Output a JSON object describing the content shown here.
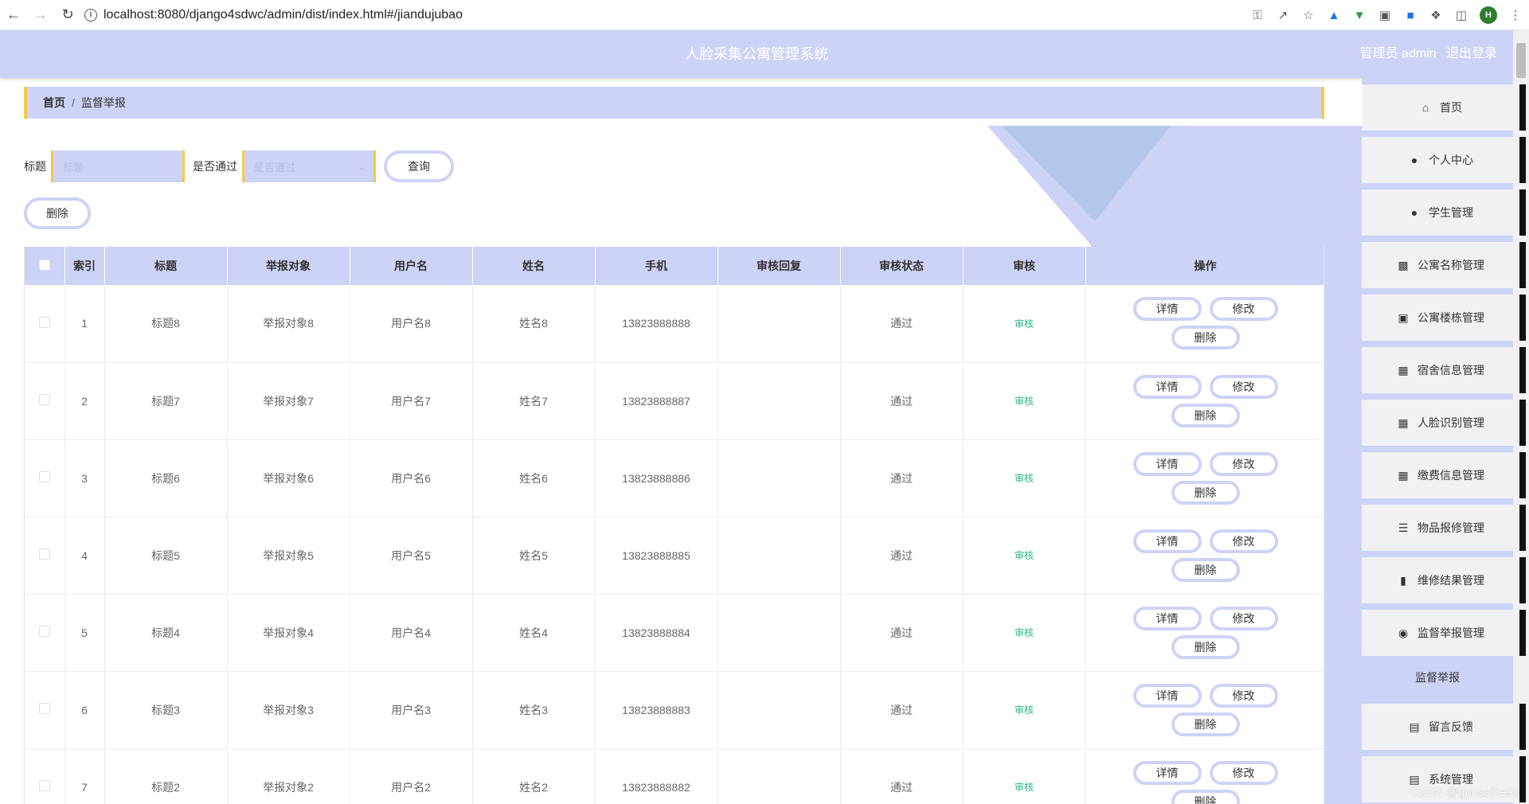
{
  "browser": {
    "url": "localhost:8080/django4sdwc/admin/dist/index.html#/jiandujubao"
  },
  "header": {
    "title": "人脸采集公寓管理系统",
    "user_role": "管理员 admin",
    "logout": "退出登录"
  },
  "breadcrumb": {
    "home": "首页",
    "separator": "/",
    "current": "监督举报"
  },
  "search": {
    "title_label": "标题",
    "title_placeholder": "标题",
    "pass_label": "是否通过",
    "pass_placeholder": "是否通过",
    "query_button": "查询"
  },
  "actions": {
    "delete_button": "删除"
  },
  "table": {
    "headers": [
      "索引",
      "标题",
      "举报对象",
      "用户名",
      "姓名",
      "手机",
      "审核回复",
      "审核状态",
      "审核",
      "操作"
    ],
    "audit_link": "审核",
    "op_detail": "详情",
    "op_edit": "修改",
    "op_delete": "删除",
    "rows": [
      {
        "index": "1",
        "title": "标题8",
        "target": "举报对象8",
        "username": "用户名8",
        "name": "姓名8",
        "phone": "13823888888",
        "reply": "",
        "status": "通过"
      },
      {
        "index": "2",
        "title": "标题7",
        "target": "举报对象7",
        "username": "用户名7",
        "name": "姓名7",
        "phone": "13823888887",
        "reply": "",
        "status": "通过"
      },
      {
        "index": "3",
        "title": "标题6",
        "target": "举报对象6",
        "username": "用户名6",
        "name": "姓名6",
        "phone": "13823888886",
        "reply": "",
        "status": "通过"
      },
      {
        "index": "4",
        "title": "标题5",
        "target": "举报对象5",
        "username": "用户名5",
        "name": "姓名5",
        "phone": "13823888885",
        "reply": "",
        "status": "通过"
      },
      {
        "index": "5",
        "title": "标题4",
        "target": "举报对象4",
        "username": "用户名4",
        "name": "姓名4",
        "phone": "13823888884",
        "reply": "",
        "status": "通过"
      },
      {
        "index": "6",
        "title": "标题3",
        "target": "举报对象3",
        "username": "用户名3",
        "name": "姓名3",
        "phone": "13823888883",
        "reply": "",
        "status": "通过"
      },
      {
        "index": "7",
        "title": "标题2",
        "target": "举报对象2",
        "username": "用户名2",
        "name": "姓名2",
        "phone": "13823888882",
        "reply": "",
        "status": "通过"
      }
    ]
  },
  "sidebar": {
    "items": [
      {
        "label": "首页",
        "icon": "home-icon"
      },
      {
        "label": "个人中心",
        "icon": "user-icon"
      },
      {
        "label": "学生管理",
        "icon": "user-icon"
      },
      {
        "label": "公寓名称管理",
        "icon": "chat-icon"
      },
      {
        "label": "公寓楼栋管理",
        "icon": "briefcase-icon"
      },
      {
        "label": "宿舍信息管理",
        "icon": "grid-icon"
      },
      {
        "label": "人脸识别管理",
        "icon": "grid-icon"
      },
      {
        "label": "缴费信息管理",
        "icon": "grid-icon"
      },
      {
        "label": "物品报修管理",
        "icon": "sliders-icon"
      },
      {
        "label": "维修结果管理",
        "icon": "book-icon"
      },
      {
        "label": "监督举报管理",
        "icon": "pin-icon"
      }
    ],
    "sub_item": "监督举报",
    "after_items": [
      {
        "label": "留言反馈",
        "icon": "clipboard-icon"
      },
      {
        "label": "系统管理",
        "icon": "clipboard-icon"
      }
    ]
  },
  "watermark": "CSDN @guosaike99",
  "colors": {
    "accent": "#cdd3f6",
    "border_accent": "#f5c949",
    "audit_green": "#2bb38a"
  }
}
